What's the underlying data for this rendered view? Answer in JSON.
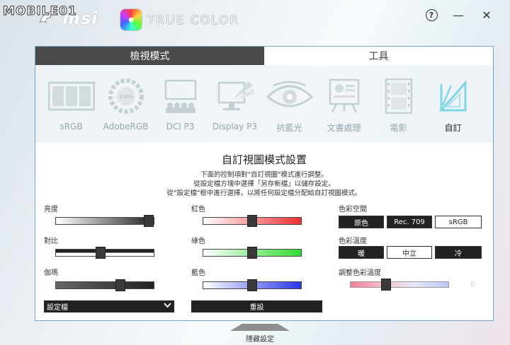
{
  "watermark": "MOBILE01",
  "brand": {
    "logo": "msi",
    "app_title": "TRUE COLOR"
  },
  "window": {
    "help": "?",
    "minimize": "—",
    "close": "✕"
  },
  "tabs": [
    {
      "label": "檢視模式"
    },
    {
      "label": "工具"
    }
  ],
  "modes": [
    {
      "label": "sRGB",
      "icon": "srgb-icon"
    },
    {
      "label": "AdobeRGB",
      "icon": "adobergb-icon"
    },
    {
      "label": "DCI P3",
      "icon": "cinema-icon"
    },
    {
      "label": "Display P3",
      "icon": "display-icon"
    },
    {
      "label": "抗藍光",
      "icon": "eye-icon"
    },
    {
      "label": "文書處理",
      "icon": "document-icon"
    },
    {
      "label": "電影",
      "icon": "film-icon"
    },
    {
      "label": "自訂",
      "icon": "custom-icon",
      "selected": true
    }
  ],
  "custom": {
    "title": "自訂視圖模式設置",
    "desc_lines": [
      "下面的控制項對\"自訂視圖\"模式進行調整。",
      "從設定檔方塊中選擇「另存新檔」以儲存設定。",
      "從\"設定檔\"框中進行選擇，以將任何設定檔分配給自訂視圖模式。"
    ],
    "brightness": {
      "label": "亮度",
      "value": 0.95
    },
    "contrast": {
      "label": "對比",
      "value": 0.46
    },
    "gamma": {
      "label": "伽瑪",
      "value": 0.66
    },
    "red": {
      "label": "紅色",
      "value": 0.5
    },
    "green": {
      "label": "綠色",
      "value": 0.5
    },
    "blue": {
      "label": "藍色",
      "value": 0.5
    },
    "color_space": {
      "label": "色彩空間",
      "options": [
        "原色",
        "Rec. 709",
        "sRGB"
      ],
      "selected": "sRGB"
    },
    "color_temp": {
      "label": "色彩溫度",
      "options": [
        "暖",
        "中立",
        "冷"
      ],
      "selected": "中立"
    },
    "hue": {
      "label": "調整色彩溫度",
      "value": 0.36,
      "value_text": "0"
    },
    "profile_dropdown": "設定檔",
    "reset": "重設"
  },
  "hide_settings": "隱藏設定"
}
